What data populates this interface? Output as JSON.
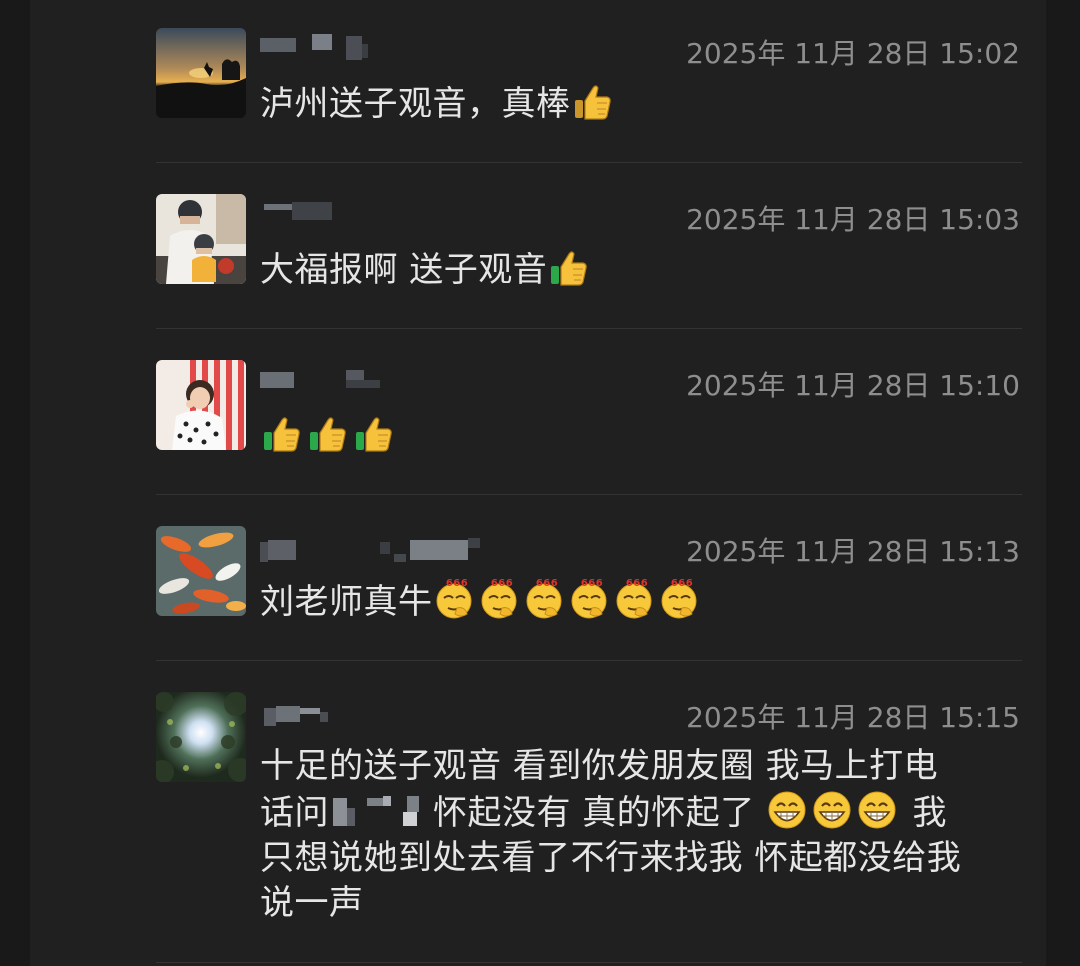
{
  "colors": {
    "background": "#191919",
    "panel": "#202020",
    "text": "#e6e6e6",
    "timestamp": "#8e8e8e",
    "divider": "#333333"
  },
  "comments": [
    {
      "time": "2025年 11月 28日 15:02",
      "text": "泸州送子观音，真棒",
      "emoji": "thumbs-up"
    },
    {
      "time": "2025年 11月 28日 15:03",
      "text": "大福报啊 送子观音",
      "emoji": "thumbs-up"
    },
    {
      "time": "2025年 11月 28日 15:10",
      "text": "",
      "emoji": "thumbs-up x3"
    },
    {
      "time": "2025年 11月 28日 15:13",
      "text": "刘老师真牛",
      "emoji": "666-emoji x6",
      "emoji_badge": "666"
    },
    {
      "time": "2025年 11月 28日 15:15",
      "text_line1": "十足的送子观音  看到你发朋友圈  我马上打电",
      "text_line2a": "话问",
      "text_line2b": "怀起没有  真的怀起了",
      "text_line2c": "我",
      "text_line3": "只想说她到处去看了不行来找我  怀起都没给我",
      "text_line4": "说一声",
      "emoji": "grinning-face x3"
    }
  ]
}
